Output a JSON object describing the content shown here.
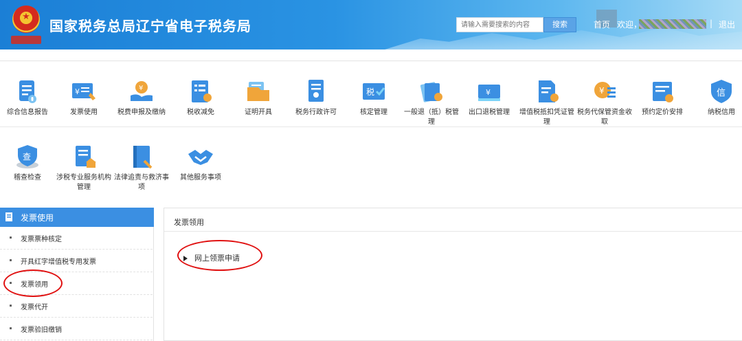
{
  "header": {
    "site_title": "国家税务总局辽宁省电子税务局",
    "logo_icon": "tax-emblem-icon",
    "search": {
      "placeholder": "请输入需要搜索的内容",
      "button_label": "搜索"
    },
    "nav": {
      "home": "首页",
      "welcome": "欢迎，",
      "separator": "|",
      "logout": "退出"
    }
  },
  "icons": [
    {
      "label": "综合信息报告",
      "icon": "report-icon"
    },
    {
      "label": "发票使用",
      "icon": "invoice-icon"
    },
    {
      "label": "税费申报及缴纳",
      "icon": "tax-payment-icon"
    },
    {
      "label": "税收减免",
      "icon": "tax-reduction-icon"
    },
    {
      "label": "证明开具",
      "icon": "certificate-icon"
    },
    {
      "label": "税务行政许可",
      "icon": "license-icon"
    },
    {
      "label": "核定管理",
      "icon": "assessment-icon"
    },
    {
      "label": "一般退（抵）税管理",
      "icon": "refund-icon"
    },
    {
      "label": "出口退税管理",
      "icon": "export-refund-icon"
    },
    {
      "label": "增值税抵扣凭证管理",
      "icon": "vat-voucher-icon"
    },
    {
      "label": "税务代保管资金收取",
      "icon": "custody-fund-icon"
    },
    {
      "label": "预约定价安排",
      "icon": "pricing-agreement-icon"
    },
    {
      "label": "纳税信用",
      "icon": "credit-icon"
    },
    {
      "label": "稽查检查",
      "icon": "inspection-icon"
    },
    {
      "label": "涉税专业服务机构管理",
      "icon": "agency-icon"
    },
    {
      "label": "法律追责与救济事项",
      "icon": "legal-icon"
    },
    {
      "label": "其他服务事项",
      "icon": "handshake-icon"
    }
  ],
  "sidebar": {
    "title": "发票使用",
    "items": [
      {
        "label": "发票票种核定"
      },
      {
        "label": "开具红字增值税专用发票"
      },
      {
        "label": "发票领用"
      },
      {
        "label": "发票代开"
      },
      {
        "label": "发票验旧缴销"
      }
    ]
  },
  "content": {
    "title": "发票领用",
    "links": [
      {
        "label": "网上领票申请"
      }
    ]
  },
  "colors": {
    "header_blue": "#2a93e3",
    "sidebar_blue": "#3b8fe2",
    "annotation_red": "#e01010"
  }
}
